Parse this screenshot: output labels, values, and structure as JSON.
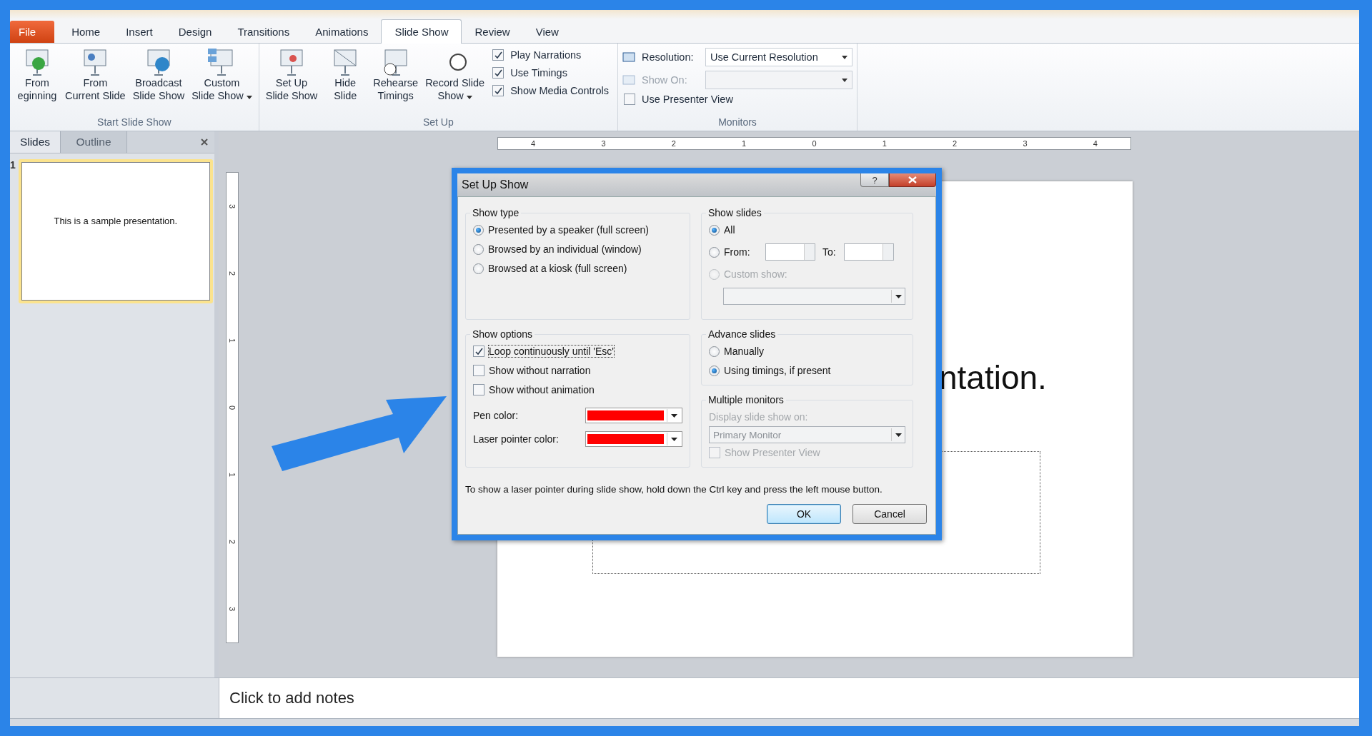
{
  "ribbon": {
    "tabs": [
      {
        "label": "File",
        "kind": "file",
        "selected": false
      },
      {
        "label": "Home",
        "kind": "tab",
        "selected": false
      },
      {
        "label": "Insert",
        "kind": "tab",
        "selected": false
      },
      {
        "label": "Design",
        "kind": "tab",
        "selected": false
      },
      {
        "label": "Transitions",
        "kind": "tab",
        "selected": false
      },
      {
        "label": "Animations",
        "kind": "tab",
        "selected": false
      },
      {
        "label": "Slide Show",
        "kind": "tab",
        "selected": true
      },
      {
        "label": "Review",
        "kind": "tab",
        "selected": false
      },
      {
        "label": "View",
        "kind": "tab",
        "selected": false
      }
    ],
    "groups": [
      {
        "label": "Start Slide Show",
        "items": [
          {
            "kind": "big",
            "lines": [
              "From",
              "eginning"
            ],
            "caret": false
          },
          {
            "kind": "big",
            "lines": [
              "From",
              "Current Slide"
            ],
            "caret": false
          },
          {
            "kind": "big",
            "lines": [
              "Broadcast",
              "Slide Show"
            ],
            "caret": false
          },
          {
            "kind": "big",
            "lines": [
              "Custom",
              "Slide Show"
            ],
            "caret": true
          }
        ]
      },
      {
        "label": "Set Up",
        "items": [
          {
            "kind": "big",
            "lines": [
              "Set Up",
              "Slide Show"
            ],
            "caret": false
          },
          {
            "kind": "big",
            "lines": [
              "Hide",
              "Slide"
            ],
            "caret": false
          },
          {
            "kind": "big",
            "lines": [
              "Rehearse",
              "Timings"
            ],
            "caret": false
          },
          {
            "kind": "big",
            "lines": [
              "Record Slide",
              "Show"
            ],
            "caret": true
          },
          {
            "kind": "checks",
            "checks": [
              {
                "label": "Play Narrations",
                "checked": true
              },
              {
                "label": "Use Timings",
                "checked": true
              },
              {
                "label": "Show Media Controls",
                "checked": true
              }
            ]
          }
        ]
      },
      {
        "label": "Monitors",
        "items": [
          {
            "kind": "select",
            "label": "Resolution:",
            "value": "Use Current Resolution",
            "disabled": false
          },
          {
            "kind": "select",
            "label": "Show On:",
            "disabled": true
          },
          {
            "kind": "check",
            "label": "Use Presenter View",
            "checked": false
          }
        ]
      }
    ]
  },
  "slides_pane": {
    "tabs": [
      {
        "label": "Slides",
        "selected": true
      },
      {
        "label": "Outline",
        "selected": false
      }
    ],
    "thumbnails": [
      {
        "number": "1",
        "text": "This is a sample presentation.",
        "selected": true
      }
    ]
  },
  "rulers": {
    "horizontal": [
      "4",
      "3",
      "2",
      "1",
      "0",
      "1",
      "2",
      "3",
      "4"
    ],
    "vertical": [
      "3",
      "2",
      "1",
      "0",
      "1",
      "2",
      "3"
    ]
  },
  "slide": {
    "visible_title": "ntation."
  },
  "notes": {
    "placeholder": "Click to add notes"
  },
  "dialog": {
    "title": "Set Up Show",
    "help": "?",
    "show_type": {
      "legend": "Show type",
      "options": [
        {
          "label": "Presented by a speaker (full screen)",
          "selected": true
        },
        {
          "label": "Browsed by an individual (window)",
          "selected": false
        },
        {
          "label": "Browsed at a kiosk (full screen)",
          "selected": false
        }
      ]
    },
    "show_slides": {
      "legend": "Show slides",
      "all": {
        "label": "All",
        "selected": true
      },
      "from": {
        "label": "From:",
        "selected": false
      },
      "to_label": "To:",
      "custom": {
        "label": "Custom show:",
        "selected": false,
        "disabled": true
      }
    },
    "show_options": {
      "legend": "Show options",
      "checks": [
        {
          "label": "Loop continuously until 'Esc'",
          "checked": true,
          "focused": true
        },
        {
          "label": "Show without narration",
          "checked": false,
          "focused": false
        },
        {
          "label": "Show without animation",
          "checked": false,
          "focused": false
        }
      ],
      "colors": [
        {
          "label": "Pen color:",
          "color": "#ff0000"
        },
        {
          "label": "Laser pointer color:",
          "color": "#ff0000"
        }
      ]
    },
    "advance_slides": {
      "legend": "Advance slides",
      "options": [
        {
          "label": "Manually",
          "selected": false
        },
        {
          "label": "Using timings, if present",
          "selected": true
        }
      ]
    },
    "multiple_monitors": {
      "legend": "Multiple monitors",
      "display_label": "Display slide show on:",
      "monitor": "Primary Monitor",
      "presenter_view": {
        "label": "Show Presenter View",
        "checked": false
      },
      "disabled": true
    },
    "note": "To show a laser pointer during slide show, hold down the Ctrl key and press the left mouse button.",
    "buttons": [
      {
        "label": "OK",
        "default": true
      },
      {
        "label": "Cancel",
        "default": false
      }
    ]
  }
}
